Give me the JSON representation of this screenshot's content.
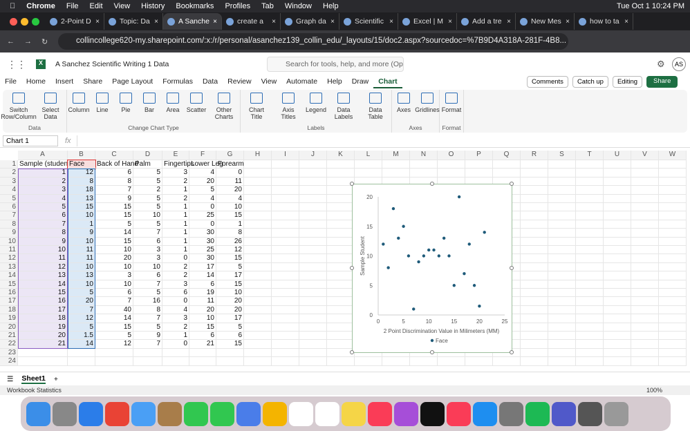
{
  "menubar": {
    "apple": "",
    "app": "Chrome",
    "items": [
      "File",
      "Edit",
      "View",
      "History",
      "Bookmarks",
      "Profiles",
      "Tab",
      "Window",
      "Help"
    ],
    "clock": "Tue Oct 1  10:24 PM"
  },
  "tabs": [
    {
      "label": "2-Point D"
    },
    {
      "label": "Topic: Da"
    },
    {
      "label": "A Sanche",
      "active": true
    },
    {
      "label": "create a"
    },
    {
      "label": "Graph da"
    },
    {
      "label": "Scientific"
    },
    {
      "label": "Excel | M"
    },
    {
      "label": "Add a tre"
    },
    {
      "label": "New Mes"
    },
    {
      "label": "how to ta"
    }
  ],
  "url": "collincollege620-my.sharepoint.com/:x:/r/personal/asanchez139_collin_edu/_layouts/15/doc2.aspx?sourcedoc=%7B9D4A318A-281F-4B8...",
  "app": {
    "title": "A Sanchez Scientific Writing 1 Data",
    "search_placeholder": "Search for tools, help, and more (Option + Q)",
    "avatar": "AS"
  },
  "menu_tabs": [
    "File",
    "Home",
    "Insert",
    "Share",
    "Page Layout",
    "Formulas",
    "Data",
    "Review",
    "View",
    "Automate",
    "Help",
    "Draw",
    "Chart"
  ],
  "actions": {
    "comments": "Comments",
    "catchup": "Catch up",
    "editing": "Editing",
    "share": "Share"
  },
  "ribbon": [
    {
      "group": "Data",
      "buttons": [
        "Switch Row/Column",
        "Select Data"
      ]
    },
    {
      "group": "Change Chart Type",
      "buttons": [
        "Column",
        "Line",
        "Pie",
        "Bar",
        "Area",
        "Scatter",
        "Other Charts"
      ]
    },
    {
      "group": "Labels",
      "buttons": [
        "Chart Title",
        "Axis Titles",
        "Legend",
        "Data Labels",
        "Data Table"
      ]
    },
    {
      "group": "Axes",
      "buttons": [
        "Axes",
        "Gridlines"
      ]
    },
    {
      "group": "Format",
      "buttons": [
        "Format"
      ]
    }
  ],
  "namebox": "Chart 1",
  "fx": "fx",
  "columns": [
    "A",
    "B",
    "C",
    "D",
    "E",
    "F",
    "G",
    "H",
    "I",
    "J",
    "K",
    "L",
    "M",
    "N",
    "O",
    "P",
    "Q",
    "R",
    "S",
    "T",
    "U",
    "V",
    "W"
  ],
  "table": {
    "headers": [
      "Sample (student)",
      "Face",
      "Back of Hand",
      "Palm",
      "Fingertips",
      "Lower Leg",
      "Forearm"
    ],
    "rows": [
      [
        1,
        12,
        6,
        5,
        3,
        4,
        0
      ],
      [
        2,
        8,
        8,
        5,
        2,
        20,
        11
      ],
      [
        3,
        18,
        7,
        2,
        1,
        5,
        20
      ],
      [
        4,
        13,
        9,
        5,
        2,
        4,
        4
      ],
      [
        5,
        15,
        15,
        5,
        1,
        0,
        10
      ],
      [
        6,
        10,
        15,
        10,
        1,
        25,
        15
      ],
      [
        7,
        1,
        5,
        5,
        1,
        0,
        1
      ],
      [
        8,
        9,
        14,
        7,
        1,
        30,
        8
      ],
      [
        9,
        10,
        15,
        6,
        1,
        30,
        26
      ],
      [
        10,
        11,
        10,
        3,
        1,
        25,
        12
      ],
      [
        11,
        11,
        20,
        3,
        0,
        30,
        15
      ],
      [
        12,
        10,
        10,
        10,
        2,
        17,
        5
      ],
      [
        13,
        13,
        3,
        6,
        2,
        14,
        17
      ],
      [
        14,
        10,
        10,
        7,
        3,
        6,
        15
      ],
      [
        15,
        5,
        6,
        5,
        6,
        19,
        10
      ],
      [
        16,
        20,
        7,
        16,
        0,
        11,
        20
      ],
      [
        17,
        7,
        40,
        8,
        4,
        20,
        20
      ],
      [
        18,
        12,
        14,
        7,
        3,
        10,
        17
      ],
      [
        19,
        5,
        15,
        5,
        2,
        15,
        5
      ],
      [
        20,
        1.5,
        5,
        9,
        1,
        6,
        6
      ],
      [
        21,
        14,
        12,
        7,
        0,
        21,
        15
      ]
    ]
  },
  "chart_data": {
    "type": "scatter",
    "xlabel": "2 Point Discrimination Value in Milimeters (MM)",
    "ylabel": "Sample Student",
    "xlim": [
      0,
      25
    ],
    "ylim": [
      0,
      20
    ],
    "xticks": [
      0,
      5,
      10,
      15,
      20,
      25
    ],
    "yticks": [
      0,
      5,
      10,
      15,
      20
    ],
    "grid": false,
    "legend": "bottom",
    "series": [
      {
        "name": "Face",
        "color": "#1f5b7a",
        "x": [
          1,
          2,
          3,
          4,
          5,
          6,
          7,
          8,
          9,
          10,
          11,
          12,
          13,
          14,
          15,
          16,
          17,
          18,
          19,
          20,
          21
        ],
        "y": [
          12,
          8,
          18,
          13,
          15,
          10,
          1,
          9,
          10,
          11,
          11,
          10,
          13,
          10,
          5,
          20,
          7,
          12,
          5,
          1.5,
          14
        ]
      }
    ]
  },
  "sheet": {
    "name": "Sheet1",
    "status": "Workbook Statistics",
    "zoom": "100%"
  }
}
